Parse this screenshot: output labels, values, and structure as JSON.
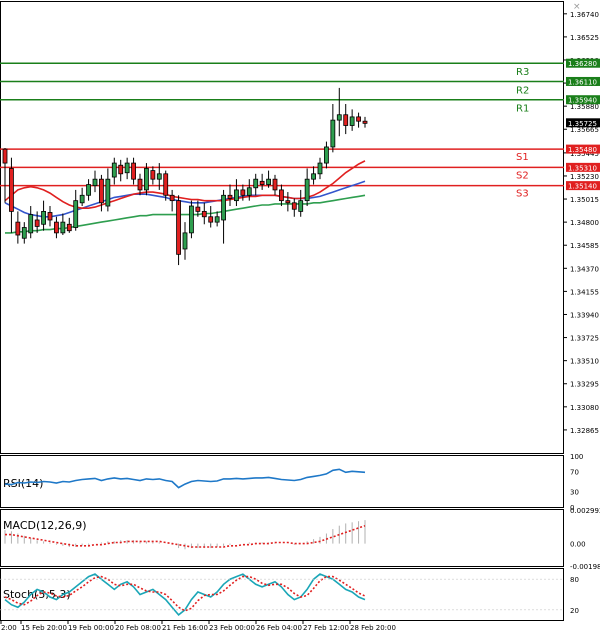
{
  "chart_data": {
    "type": "candlestick",
    "main": {
      "ylim": [
        1.3265,
        1.3685
      ],
      "y_ticks": [
        "1.36740",
        "1.36525",
        "1.36310",
        "1.36095",
        "1.35880",
        "1.35665",
        "1.35445",
        "1.35230",
        "1.35015",
        "1.34800",
        "1.34585",
        "1.34370",
        "1.34155",
        "1.33940",
        "1.33725",
        "1.33510",
        "1.33295",
        "1.33080",
        "1.32865"
      ],
      "levels": [
        {
          "name": "R3",
          "value": 1.3628,
          "label": "1.36280",
          "color": "#1a7f1a"
        },
        {
          "name": "R2",
          "value": 1.3611,
          "label": "1.36110",
          "color": "#1a7f1a"
        },
        {
          "name": "R1",
          "value": 1.3594,
          "label": "1.35940",
          "color": "#1a7f1a"
        },
        {
          "name": "S1",
          "value": 1.3548,
          "label": "1.35480",
          "color": "#e02020"
        },
        {
          "name": "S2",
          "value": 1.3531,
          "label": "1.35310",
          "color": "#e02020"
        },
        {
          "name": "S3",
          "value": 1.3514,
          "label": "1.35140",
          "color": "#e02020"
        }
      ],
      "current_price": "1.35725",
      "candles": [
        [
          1.3548,
          1.3535,
          1.3549,
          1.3498
        ],
        [
          1.353,
          1.349,
          1.354,
          1.347
        ],
        [
          1.348,
          1.3468,
          1.349,
          1.346
        ],
        [
          1.3465,
          1.3475,
          1.348,
          1.346
        ],
        [
          1.347,
          1.3487,
          1.3495,
          1.3465
        ],
        [
          1.3482,
          1.3476,
          1.349,
          1.347
        ],
        [
          1.3478,
          1.349,
          1.35,
          1.3472
        ],
        [
          1.3489,
          1.3482,
          1.3495,
          1.3476
        ],
        [
          1.348,
          1.347,
          1.3485,
          1.3465
        ],
        [
          1.347,
          1.348,
          1.3488,
          1.3468
        ],
        [
          1.3478,
          1.3472,
          1.3484,
          1.347
        ],
        [
          1.3475,
          1.35,
          1.351,
          1.3472
        ],
        [
          1.3498,
          1.3505,
          1.3512,
          1.3495
        ],
        [
          1.3505,
          1.3515,
          1.352,
          1.35
        ],
        [
          1.3514,
          1.352,
          1.3528,
          1.3508
        ],
        [
          1.352,
          1.3498,
          1.3524,
          1.349
        ],
        [
          1.3495,
          1.352,
          1.353,
          1.349
        ],
        [
          1.3522,
          1.3535,
          1.354,
          1.3515
        ],
        [
          1.3533,
          1.3525,
          1.3538,
          1.3518
        ],
        [
          1.3526,
          1.3535,
          1.354,
          1.352
        ],
        [
          1.3535,
          1.352,
          1.354,
          1.3515
        ],
        [
          1.352,
          1.351,
          1.3525,
          1.3505
        ],
        [
          1.351,
          1.353,
          1.3535,
          1.3505
        ],
        [
          1.3528,
          1.352,
          1.3532,
          1.3515
        ],
        [
          1.352,
          1.3525,
          1.3535,
          1.351
        ],
        [
          1.3525,
          1.3505,
          1.3528,
          1.35
        ],
        [
          1.3505,
          1.35,
          1.351,
          1.349
        ],
        [
          1.35,
          1.345,
          1.3505,
          1.344
        ],
        [
          1.3455,
          1.347,
          1.348,
          1.3445
        ],
        [
          1.347,
          1.3495,
          1.35,
          1.3465
        ],
        [
          1.3494,
          1.349,
          1.35,
          1.3485
        ],
        [
          1.349,
          1.3485,
          1.3498,
          1.3478
        ],
        [
          1.3485,
          1.348,
          1.3495,
          1.3475
        ],
        [
          1.348,
          1.3485,
          1.349,
          1.3476
        ],
        [
          1.3482,
          1.3505,
          1.351,
          1.346
        ],
        [
          1.3505,
          1.3502,
          1.3515,
          1.3495
        ],
        [
          1.35,
          1.351,
          1.352,
          1.3495
        ],
        [
          1.351,
          1.3505,
          1.3515,
          1.35
        ],
        [
          1.3505,
          1.3512,
          1.352,
          1.35
        ],
        [
          1.3512,
          1.352,
          1.3525,
          1.3505
        ],
        [
          1.3518,
          1.3515,
          1.3525,
          1.351
        ],
        [
          1.3515,
          1.352,
          1.3528,
          1.3512
        ],
        [
          1.352,
          1.351,
          1.3524,
          1.3505
        ],
        [
          1.351,
          1.35,
          1.3515,
          1.3495
        ],
        [
          1.35,
          1.3498,
          1.3508,
          1.349
        ],
        [
          1.3498,
          1.3492,
          1.3502,
          1.3485
        ],
        [
          1.349,
          1.35,
          1.351,
          1.3485
        ],
        [
          1.35,
          1.352,
          1.353,
          1.3495
        ],
        [
          1.352,
          1.3525,
          1.3532,
          1.3515
        ],
        [
          1.3525,
          1.3535,
          1.354,
          1.352
        ],
        [
          1.3535,
          1.355,
          1.3555,
          1.353
        ],
        [
          1.355,
          1.3575,
          1.359,
          1.3545
        ],
        [
          1.3575,
          1.358,
          1.3605,
          1.356
        ],
        [
          1.358,
          1.357,
          1.359,
          1.3562
        ],
        [
          1.357,
          1.3578,
          1.3585,
          1.3565
        ],
        [
          1.3578,
          1.3574,
          1.3582,
          1.3568
        ],
        [
          1.3574,
          1.3572,
          1.3578,
          1.3568
        ]
      ],
      "ma_red": [
        1.35,
        1.3505,
        1.351,
        1.3512,
        1.3513,
        1.3512,
        1.351,
        1.3507,
        1.3503,
        1.3499,
        1.3496,
        1.3494,
        1.3493,
        1.3493,
        1.3494,
        1.3496,
        1.3498,
        1.35,
        1.3502,
        1.3504,
        1.3506,
        1.3507,
        1.3508,
        1.3508,
        1.3507,
        1.3506,
        1.3504,
        1.3503,
        1.3502,
        1.3501,
        1.3501,
        1.35,
        1.35,
        1.35,
        1.35,
        1.3501,
        1.3502,
        1.3503,
        1.3504,
        1.3504,
        1.3505,
        1.3505,
        1.3505,
        1.3504,
        1.3503,
        1.3502,
        1.3502,
        1.3503,
        1.3505,
        1.3508,
        1.3512,
        1.3516,
        1.3521,
        1.3526,
        1.353,
        1.3534,
        1.3537
      ],
      "ma_blue": [
        1.3498,
        1.3495,
        1.3492,
        1.3489,
        1.3487,
        1.3486,
        1.3485,
        1.3485,
        1.3486,
        1.3487,
        1.3489,
        1.3491,
        1.3493,
        1.3495,
        1.3497,
        1.3499,
        1.3501,
        1.3503,
        1.3504,
        1.3505,
        1.3506,
        1.3506,
        1.3506,
        1.3505,
        1.3504,
        1.3503,
        1.3501,
        1.35,
        1.3499,
        1.3498,
        1.3498,
        1.3498,
        1.3499,
        1.35,
        1.3501,
        1.3502,
        1.3503,
        1.3504,
        1.3505,
        1.3505,
        1.3505,
        1.3505,
        1.3505,
        1.3504,
        1.3503,
        1.3502,
        1.3502,
        1.3502,
        1.3503,
        1.3504,
        1.3506,
        1.3508,
        1.351,
        1.3512,
        1.3514,
        1.3516,
        1.3518
      ],
      "ma_green": [
        1.347,
        1.347,
        1.3471,
        1.3471,
        1.3472,
        1.3472,
        1.3473,
        1.3473,
        1.3474,
        1.3474,
        1.3475,
        1.3476,
        1.3477,
        1.3478,
        1.3479,
        1.348,
        1.3481,
        1.3482,
        1.3483,
        1.3484,
        1.3485,
        1.3486,
        1.3486,
        1.3487,
        1.3487,
        1.3487,
        1.3487,
        1.3487,
        1.3487,
        1.3487,
        1.3487,
        1.3488,
        1.3488,
        1.3489,
        1.349,
        1.3491,
        1.3492,
        1.3493,
        1.3494,
        1.3495,
        1.3496,
        1.3496,
        1.3497,
        1.3497,
        1.3497,
        1.3497,
        1.3497,
        1.3497,
        1.3498,
        1.3498,
        1.3499,
        1.35,
        1.3501,
        1.3502,
        1.3503,
        1.3504,
        1.3505
      ]
    },
    "rsi": {
      "label": "RSI(14)",
      "ylim": [
        0,
        100
      ],
      "ticks": [
        "100",
        "70",
        "30",
        "0"
      ],
      "values": [
        45,
        44,
        48,
        47,
        49,
        48,
        50,
        49,
        47,
        50,
        49,
        52,
        54,
        55,
        56,
        52,
        55,
        57,
        55,
        56,
        54,
        52,
        55,
        54,
        55,
        52,
        50,
        38,
        45,
        50,
        52,
        51,
        50,
        51,
        55,
        55,
        56,
        55,
        56,
        57,
        57,
        58,
        56,
        54,
        53,
        52,
        54,
        58,
        60,
        62,
        65,
        72,
        74,
        68,
        70,
        69,
        68
      ]
    },
    "macd": {
      "label": "MACD(12,26,9)",
      "ylim": [
        -0.002,
        0.003
      ],
      "ticks": [
        "0.002992",
        "0.00",
        "-0.001985"
      ],
      "hist": [
        0.0012,
        0.0011,
        0.0009,
        0.0007,
        0.0005,
        0.0003,
        0.0002,
        0.0001,
        -0.0001,
        -0.0002,
        -0.0003,
        -0.0003,
        -0.0002,
        -0.0001,
        0.0,
        0.0001,
        0.0002,
        0.0002,
        0.0003,
        0.0003,
        0.0003,
        0.0002,
        0.0002,
        0.0002,
        0.0001,
        0.0,
        -0.0001,
        -0.0004,
        -0.0005,
        -0.0004,
        -0.0004,
        -0.0004,
        -0.0004,
        -0.0003,
        -0.0002,
        -0.0001,
        0.0,
        0.0,
        0.0001,
        0.0001,
        0.0001,
        0.0001,
        0.0001,
        0.0,
        0.0,
        -0.0001,
        0.0,
        0.0002,
        0.0004,
        0.0006,
        0.0009,
        0.0013,
        0.0016,
        0.0018,
        0.0019,
        0.002,
        0.0021
      ],
      "signal": [
        0.0008,
        0.0008,
        0.0007,
        0.0006,
        0.0005,
        0.0004,
        0.0003,
        0.0002,
        0.0001,
        0.0,
        -0.0001,
        -0.0002,
        -0.0002,
        -0.0002,
        -0.0001,
        -0.0001,
        0.0,
        0.0001,
        0.0001,
        0.0002,
        0.0002,
        0.0002,
        0.0002,
        0.0002,
        0.0002,
        0.0001,
        0.0,
        -0.0001,
        -0.0002,
        -0.0003,
        -0.0003,
        -0.0003,
        -0.0003,
        -0.0003,
        -0.0003,
        -0.0002,
        -0.0002,
        -0.0001,
        -0.0001,
        0.0,
        0.0,
        0.0,
        0.0001,
        0.0001,
        0.0001,
        0.0,
        0.0,
        0.0,
        0.0001,
        0.0002,
        0.0004,
        0.0006,
        0.0008,
        0.001,
        0.0012,
        0.0014,
        0.0016
      ]
    },
    "stoch": {
      "label": "Stoch(5,5,3)",
      "ylim": [
        0,
        100
      ],
      "ticks": [
        "80",
        "20"
      ],
      "k": [
        40,
        30,
        25,
        35,
        50,
        60,
        55,
        45,
        40,
        50,
        55,
        65,
        75,
        85,
        90,
        80,
        70,
        60,
        70,
        75,
        65,
        50,
        55,
        60,
        50,
        40,
        25,
        10,
        20,
        40,
        55,
        50,
        45,
        55,
        70,
        80,
        85,
        90,
        80,
        70,
        65,
        70,
        75,
        65,
        50,
        40,
        45,
        60,
        80,
        90,
        85,
        80,
        70,
        60,
        55,
        45,
        40
      ],
      "d": [
        45,
        40,
        33,
        30,
        37,
        48,
        55,
        53,
        47,
        45,
        48,
        57,
        65,
        75,
        83,
        85,
        80,
        70,
        67,
        70,
        70,
        63,
        57,
        55,
        55,
        50,
        38,
        25,
        18,
        23,
        38,
        48,
        50,
        50,
        57,
        68,
        78,
        85,
        85,
        80,
        72,
        68,
        70,
        70,
        63,
        52,
        45,
        48,
        62,
        77,
        85,
        85,
        78,
        70,
        62,
        53,
        47
      ]
    },
    "x_labels": [
      "2:00",
      "15 Feb 20:00",
      "19 Feb 00:00",
      "20 Feb 08:00",
      "21 Feb 16:00",
      "23 Feb 00:00",
      "26 Feb 04:00",
      "27 Feb 12:00",
      "28 Feb 20:00"
    ]
  }
}
